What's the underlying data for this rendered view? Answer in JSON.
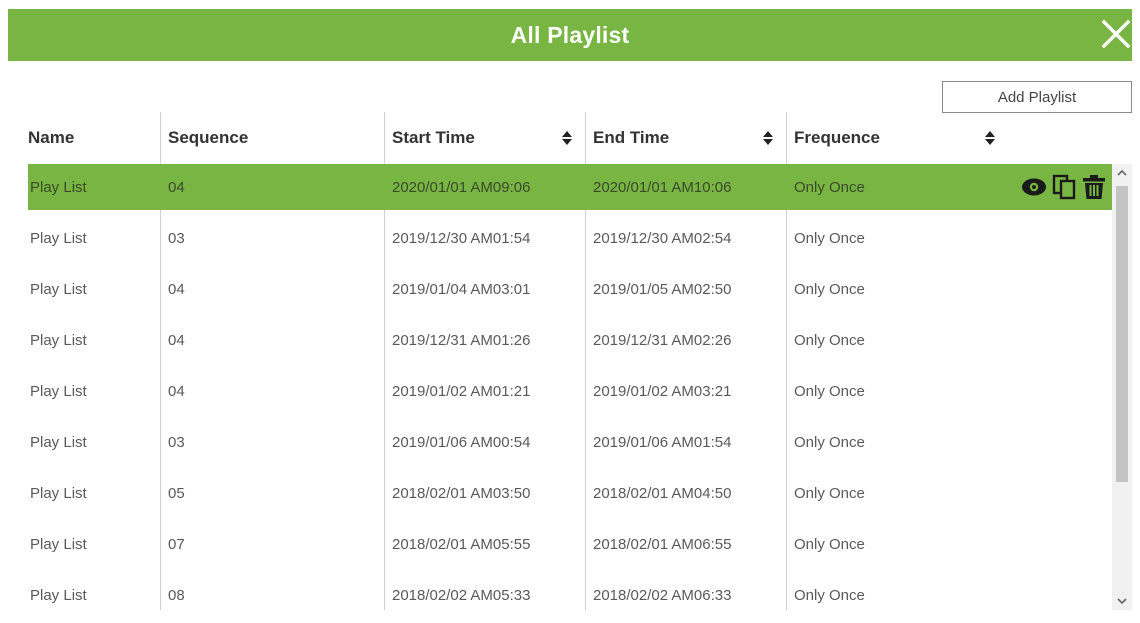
{
  "dialog": {
    "title": "All Playlist",
    "close_icon": "close-icon"
  },
  "toolbar": {
    "add_label": "Add Playlist"
  },
  "table": {
    "columns": [
      {
        "label": "Name",
        "sortable": false
      },
      {
        "label": "Sequence",
        "sortable": false
      },
      {
        "label": "Start Time",
        "sortable": true
      },
      {
        "label": "End Time",
        "sortable": true
      },
      {
        "label": "Frequence",
        "sortable": true
      }
    ],
    "rows": [
      {
        "name": "Play List",
        "sequence": "04",
        "start": "2020/01/01 AM09:06",
        "end": "2020/01/01 AM10:06",
        "frequence": "Only Once",
        "selected": true
      },
      {
        "name": "Play List",
        "sequence": "03",
        "start": "2019/12/30 AM01:54",
        "end": "2019/12/30 AM02:54",
        "frequence": "Only Once"
      },
      {
        "name": "Play List",
        "sequence": "04",
        "start": "2019/01/04 AM03:01",
        "end": "2019/01/05 AM02:50",
        "frequence": "Only Once"
      },
      {
        "name": "Play List",
        "sequence": "04",
        "start": "2019/12/31 AM01:26",
        "end": "2019/12/31 AM02:26",
        "frequence": "Only Once"
      },
      {
        "name": "Play List",
        "sequence": "04",
        "start": "2019/01/02 AM01:21",
        "end": "2019/01/02 AM03:21",
        "frequence": "Only Once"
      },
      {
        "name": "Play List",
        "sequence": "03",
        "start": "2019/01/06 AM00:54",
        "end": "2019/01/06 AM01:54",
        "frequence": "Only Once"
      },
      {
        "name": "Play List",
        "sequence": "05",
        "start": "2018/02/01 AM03:50",
        "end": "2018/02/01 AM04:50",
        "frequence": "Only Once"
      },
      {
        "name": "Play List",
        "sequence": "07",
        "start": "2018/02/01 AM05:55",
        "end": "2018/02/01 AM06:55",
        "frequence": "Only Once"
      },
      {
        "name": "Play List",
        "sequence": "08",
        "start": "2018/02/02 AM05:33",
        "end": "2018/02/02 AM06:33",
        "frequence": "Only Once"
      }
    ],
    "row_action_icons": [
      "eye-icon",
      "copy-icon",
      "trash-icon"
    ]
  },
  "colors": {
    "accent": "#78b543",
    "header_text": "#333333",
    "cell_text": "#5a5a5a"
  }
}
